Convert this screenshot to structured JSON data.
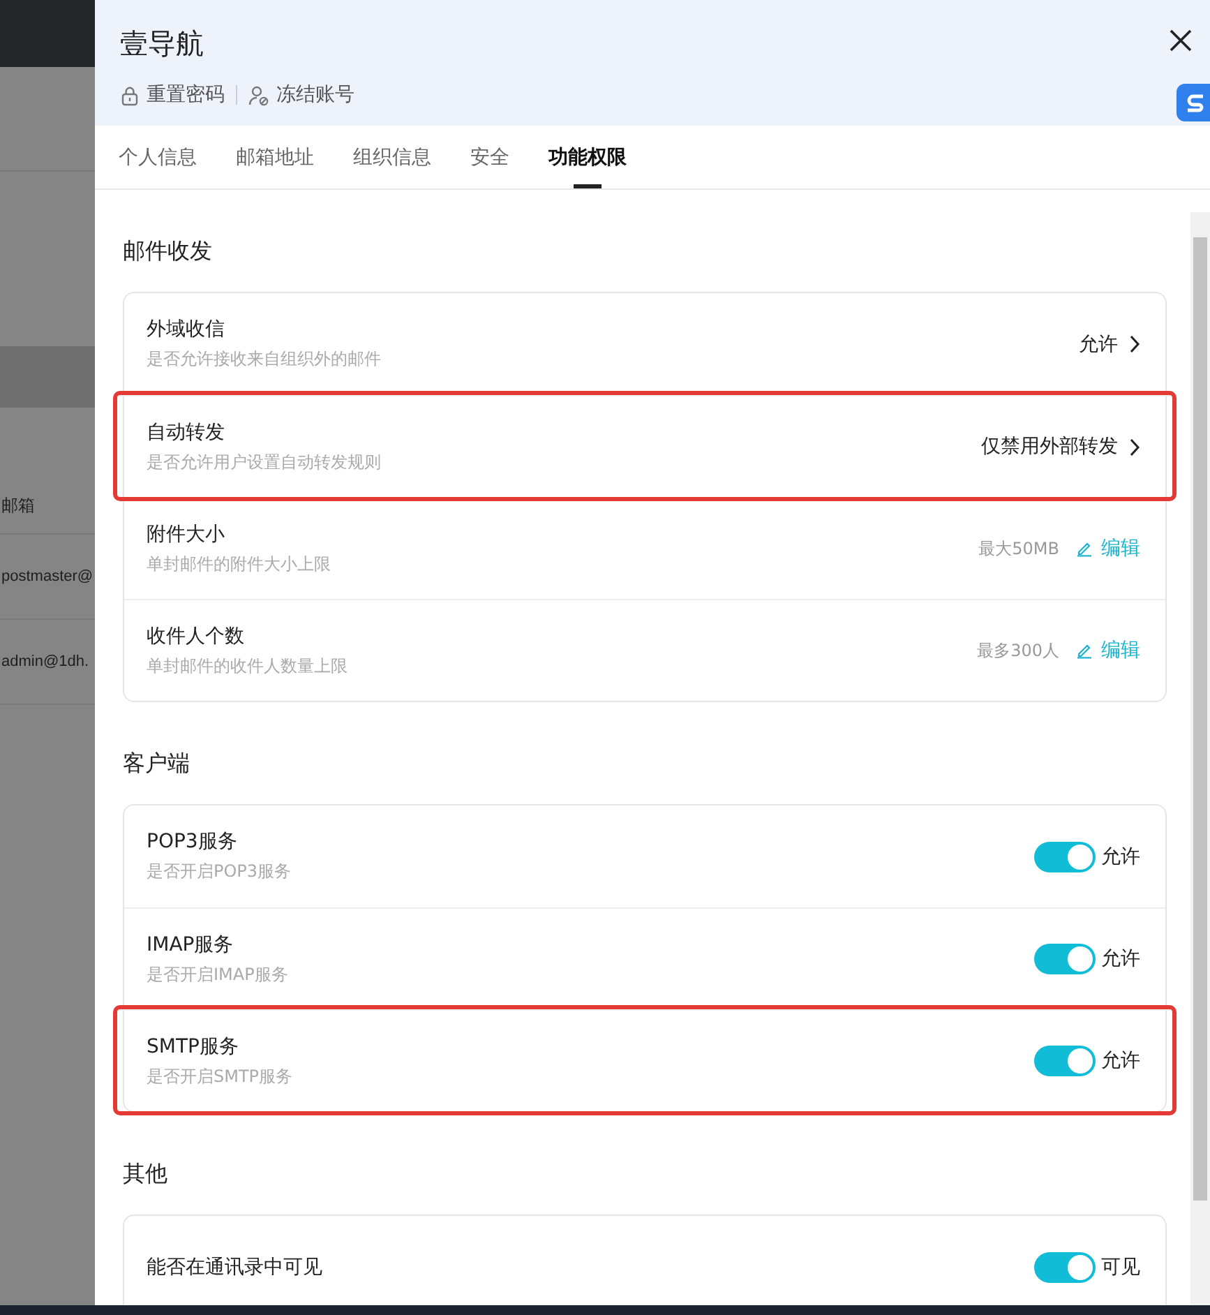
{
  "background": {
    "column_label": "邮箱",
    "rows": [
      "postmaster@",
      "admin@1dh."
    ]
  },
  "drawer": {
    "title": "壹导航",
    "actions": [
      {
        "kind": "lock",
        "label": "重置密码"
      },
      {
        "kind": "user",
        "label": "冻结账号"
      }
    ],
    "tabs": [
      {
        "label": "个人信息",
        "selected": false
      },
      {
        "label": "邮箱地址",
        "selected": false
      },
      {
        "label": "组织信息",
        "selected": false
      },
      {
        "label": "安全",
        "selected": false
      },
      {
        "label": "功能权限",
        "selected": true
      }
    ],
    "sections": [
      {
        "title": "邮件收发",
        "rows": [
          {
            "kind": "link",
            "title": "外域收信",
            "description": "是否允许接收来自组织外的邮件",
            "value": "允许",
            "highlighted": false
          },
          {
            "kind": "link",
            "title": "自动转发",
            "description": "是否允许用户设置自动转发规则",
            "value": "仅禁用外部转发",
            "highlighted": true
          },
          {
            "kind": "edit",
            "title": "附件大小",
            "description": "单封邮件的附件大小上限",
            "value": "最大50MB",
            "action": "编辑",
            "highlighted": false
          },
          {
            "kind": "edit",
            "title": "收件人个数",
            "description": "单封邮件的收件人数量上限",
            "value": "最多300人",
            "action": "编辑",
            "highlighted": false
          }
        ]
      },
      {
        "title": "客户端",
        "rows": [
          {
            "kind": "toggle",
            "title": "POP3服务",
            "description": "是否开启POP3服务",
            "on": true,
            "value": "允许",
            "highlighted": false
          },
          {
            "kind": "toggle",
            "title": "IMAP服务",
            "description": "是否开启IMAP服务",
            "on": true,
            "value": "允许",
            "highlighted": false
          },
          {
            "kind": "toggle",
            "title": "SMTP服务",
            "description": "是否开启SMTP服务",
            "on": true,
            "value": "允许",
            "highlighted": true
          }
        ]
      },
      {
        "title": "其他",
        "rows": [
          {
            "kind": "toggle",
            "title": "能否在通讯录中可见",
            "on": true,
            "value": "可见",
            "highlighted": false
          }
        ]
      }
    ]
  }
}
